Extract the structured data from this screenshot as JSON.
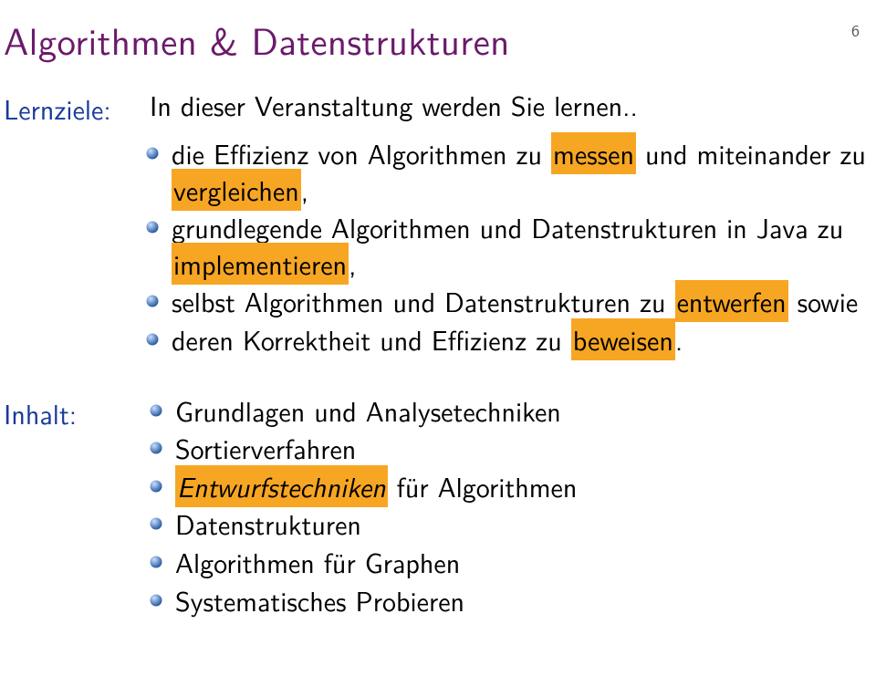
{
  "pageNumber": "6",
  "title": "Algorithmen & Datenstrukturen",
  "lernziele": {
    "label": "Lernziele:",
    "intro": "In dieser Veranstaltung werden Sie lernen..",
    "items": {
      "i0": {
        "t0": "die Effizienz von Algorithmen zu ",
        "h0": "messen",
        "t1": " und miteinander zu ",
        "h1": "vergleichen",
        "t2": ","
      },
      "i1": {
        "t0": "grundlegende Algorithmen und Datenstrukturen in Java zu ",
        "h0": "implementieren",
        "t1": ","
      },
      "i2": {
        "t0": "selbst Algorithmen und Datenstrukturen zu ",
        "h0": "entwerfen",
        "t1": " sowie"
      },
      "i3": {
        "t0": "deren Korrektheit und Effizienz zu ",
        "h0": "beweisen",
        "t1": "."
      }
    }
  },
  "inhalt": {
    "label": "Inhalt:",
    "items": {
      "i0": "Grundlagen und Analysetechniken",
      "i1": "Sortierverfahren",
      "i2": {
        "h0": "Entwurfstechniken",
        "t0": " für Algorithmen"
      },
      "i3": "Datenstrukturen",
      "i4": "Algorithmen für Graphen",
      "i5": "Systematisches Probieren"
    }
  }
}
